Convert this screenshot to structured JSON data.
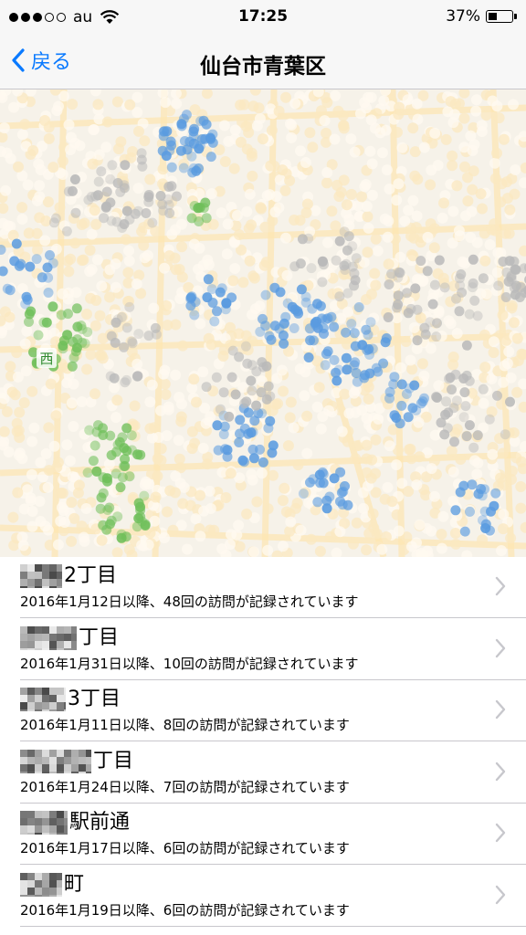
{
  "status_bar": {
    "carrier": "au",
    "time": "17:25",
    "battery_percent": "37%",
    "battery_level": 0.37,
    "signal_strength_bars": 3,
    "signal_total_bars": 5
  },
  "nav": {
    "back_label": "戻る",
    "title": "仙台市青葉区"
  },
  "map": {
    "label": "西",
    "accent_colors": {
      "blue": "#5a9be0",
      "green": "#6fbf5a",
      "gray": "#b9b9b9",
      "cream": "#fbe8c0"
    }
  },
  "visits": [
    {
      "title": "2丁目",
      "subtitle": "2016年1月12日以降、48回の訪問が記録されています"
    },
    {
      "title": "丁目",
      "subtitle": "2016年1月31日以降、10回の訪問が記録されています"
    },
    {
      "title": "3丁目",
      "subtitle": "2016年1月11日以降、8回の訪問が記録されています"
    },
    {
      "title": "丁目",
      "subtitle": "2016年1月24日以降、7回の訪問が記録されています"
    },
    {
      "title": "駅前通",
      "subtitle": "2016年1月17日以降、6回の訪問が記録されています"
    },
    {
      "title": "町",
      "subtitle": "2016年1月19日以降、6回の訪問が記録されています"
    }
  ]
}
